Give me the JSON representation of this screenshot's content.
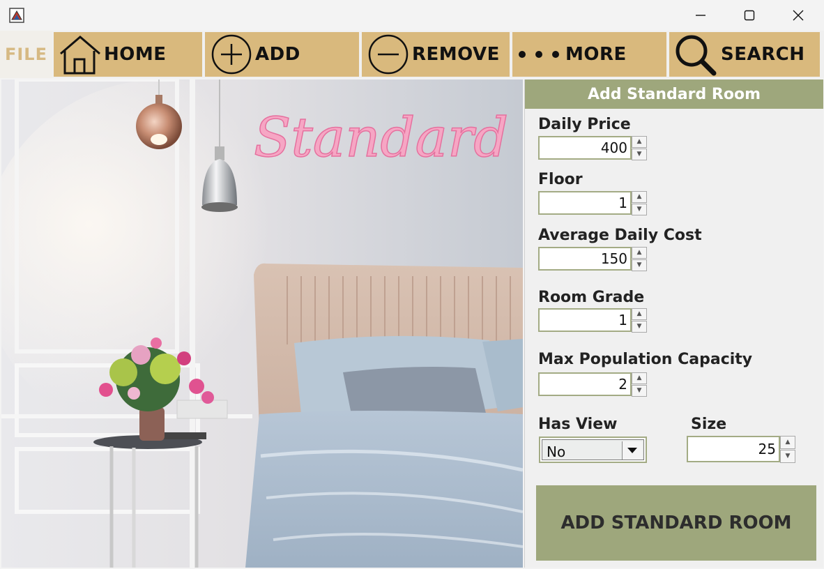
{
  "window": {
    "app_icon": "java-app-icon",
    "controls": [
      "minimize-icon",
      "maximize-icon",
      "close-icon"
    ]
  },
  "toolbar": {
    "file_label": "FILE",
    "home_label": "HOME",
    "add_label": "ADD",
    "remove_label": "REMOVE",
    "more_label": "MORE",
    "search_label": "SEARCH",
    "icons": [
      "house-icon",
      "plus-circle-icon",
      "minus-circle-icon",
      "more-dots-icon",
      "magnifier-icon"
    ],
    "colors": {
      "button_bg": "#d9b97d",
      "file_text": "#d6b983"
    }
  },
  "banner": {
    "sign_text": "Standard"
  },
  "form": {
    "title": "Add Standard Room",
    "daily_price": {
      "label": "Daily Price",
      "value": "400"
    },
    "floor": {
      "label": "Floor",
      "value": "1"
    },
    "average_daily_cost": {
      "label": "Average Daily Cost",
      "value": "150"
    },
    "room_grade": {
      "label": "Room Grade",
      "value": "1"
    },
    "max_population": {
      "label": "Max Population Capacity",
      "value": "2"
    },
    "has_view": {
      "label": "Has View",
      "value": "No"
    },
    "size": {
      "label": "Size",
      "value": "25"
    },
    "submit_label": "ADD STANDARD ROOM",
    "colors": {
      "accent": "#9ea77c",
      "field_border": "#a3ab84"
    }
  }
}
